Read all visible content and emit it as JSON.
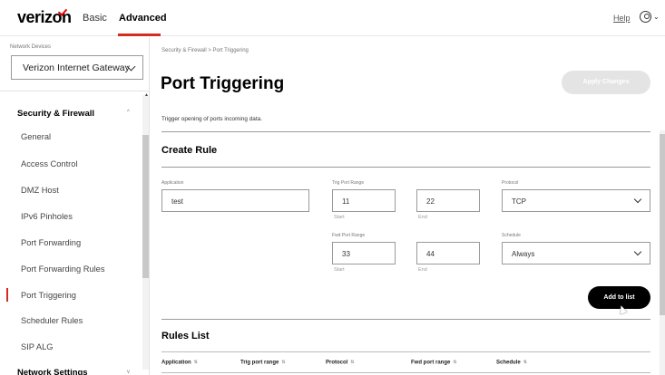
{
  "topnav": {
    "logo": "verizon",
    "tabs": [
      "Basic",
      "Advanced"
    ],
    "active_tab": "Advanced",
    "help": "Help",
    "user_chevron": "⌄"
  },
  "sidebar": {
    "network_devices_label": "Network Devices",
    "device_selected": "Verizon Internet Gateway",
    "section": "Security & Firewall",
    "items": [
      {
        "label": "General"
      },
      {
        "label": "Access Control"
      },
      {
        "label": "DMZ Host"
      },
      {
        "label": "IPv6 Pinholes"
      },
      {
        "label": "Port Forwarding"
      },
      {
        "label": "Port Forwarding Rules"
      },
      {
        "label": "Port Triggering"
      },
      {
        "label": "Scheduler Rules"
      },
      {
        "label": "SIP ALG"
      }
    ],
    "active_item": "Port Triggering",
    "next_section": "Network Settings"
  },
  "main": {
    "breadcrumb": "Security & Firewall  >  Port Triggering",
    "title": "Port Triggering",
    "apply_button": "Apply Changes",
    "description": "Trigger opening of ports incoming data.",
    "create_rule": {
      "title": "Create Rule",
      "application_label": "Application",
      "application_value": "test",
      "trig_port_range_label": "Trig Port Range",
      "trig_start": "11",
      "trig_end": "22",
      "fwd_port_range_label": "Fwd Port Range",
      "fwd_start": "33",
      "fwd_end": "44",
      "start_label": "Start",
      "end_label": "End",
      "protocol_label": "Protocol",
      "protocol_value": "TCP",
      "schedule_label": "Schedule",
      "schedule_value": "Always",
      "add_button": "Add to list"
    },
    "rules_list": {
      "title": "Rules List",
      "columns": [
        "Application",
        "Trig port range",
        "Protocol",
        "Fwd port range",
        "Schedule"
      ]
    }
  },
  "colors": {
    "accent": "#d52b1e",
    "primary_button": "#000000",
    "disabled_button": "#e4e4e4"
  }
}
